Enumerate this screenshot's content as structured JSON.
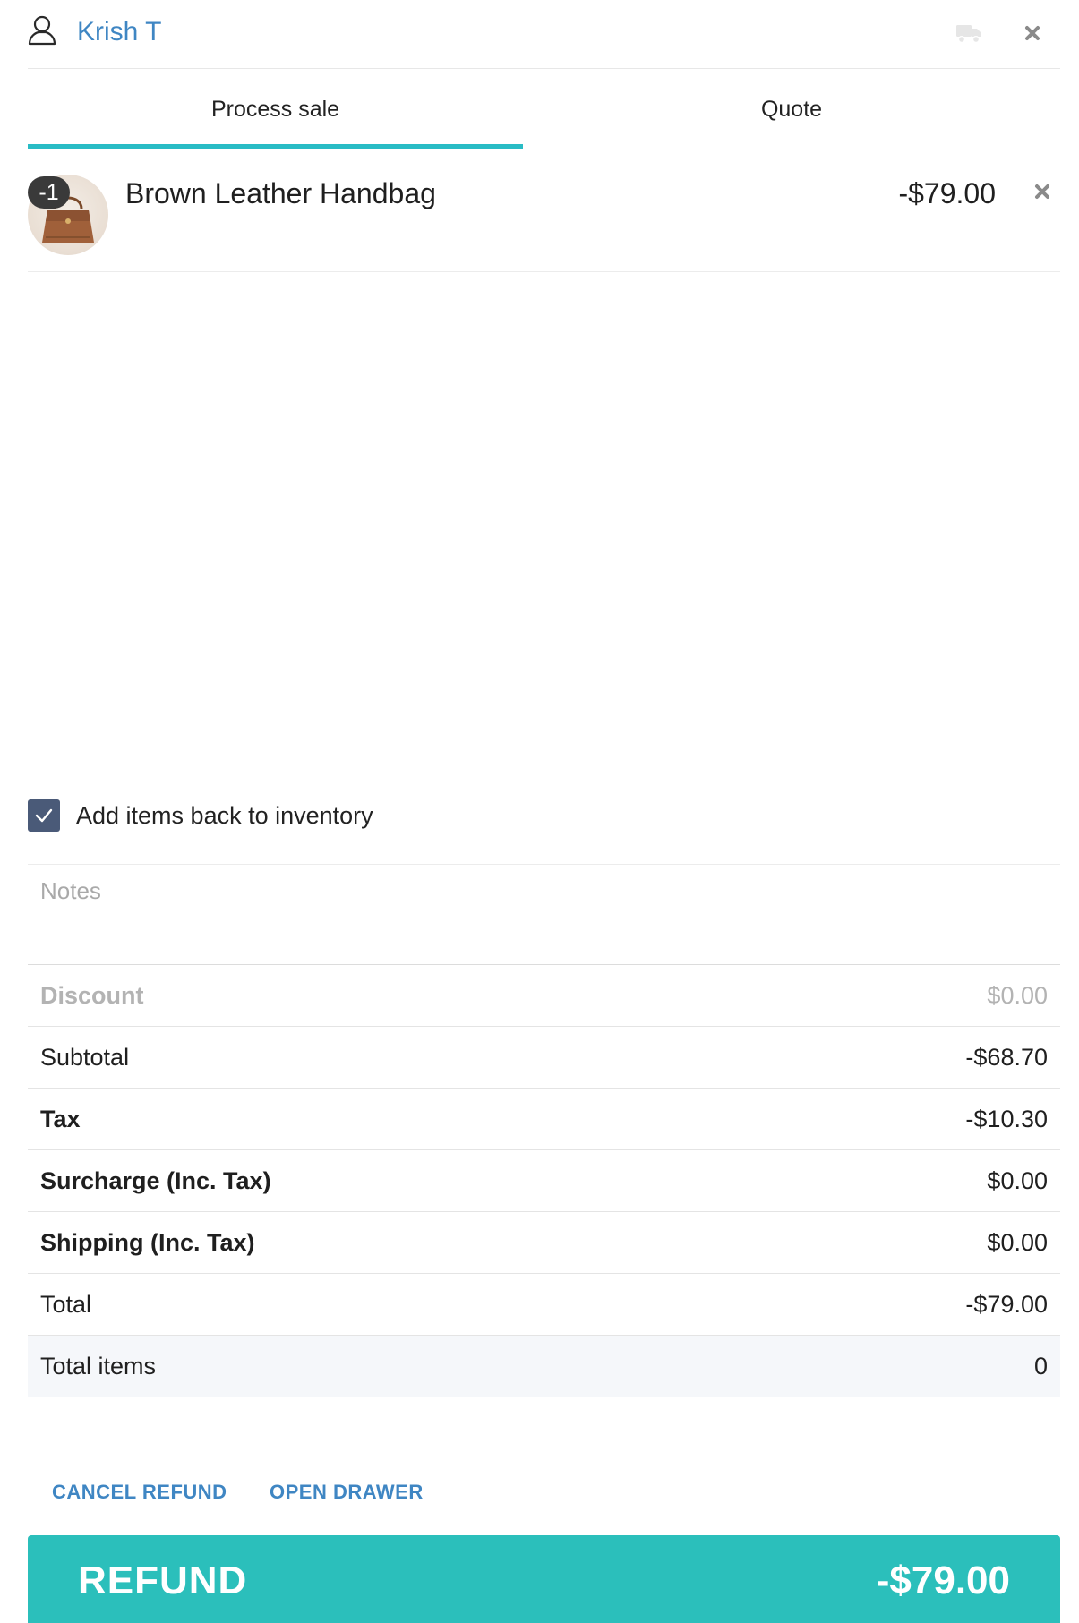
{
  "header": {
    "customer_name": "Krish T",
    "user_icon": "user-outline-icon",
    "truck_icon": "truck-icon",
    "close_icon": "close-icon"
  },
  "tabs": [
    {
      "label": "Process sale",
      "active": true
    },
    {
      "label": "Quote",
      "active": false
    }
  ],
  "accent_color": "#29bcc5",
  "line_items": [
    {
      "quantity": "-1",
      "name": "Brown Leather Handbag",
      "price": "-$79.00",
      "thumbnail": "handbag-image",
      "remove_icon": "close-icon"
    }
  ],
  "inventory": {
    "checked": true,
    "label": "Add items back to inventory"
  },
  "notes": {
    "placeholder": "Notes",
    "value": ""
  },
  "summary": {
    "discount": {
      "label": "Discount",
      "value": "$0.00"
    },
    "subtotal": {
      "label": "Subtotal",
      "value": "-$68.70"
    },
    "tax": {
      "label": "Tax",
      "value": "-$10.30"
    },
    "surcharge": {
      "label": "Surcharge (Inc. Tax)",
      "value": "$0.00"
    },
    "shipping": {
      "label": "Shipping (Inc. Tax)",
      "value": "$0.00"
    },
    "total": {
      "label": "Total",
      "value": "-$79.00"
    },
    "total_items": {
      "label": "Total items",
      "value": "0"
    }
  },
  "actions": {
    "cancel_refund": "CANCEL REFUND",
    "open_drawer": "OPEN DRAWER"
  },
  "refund": {
    "label": "REFUND",
    "amount": "-$79.00",
    "color": "#2bbfbb"
  }
}
